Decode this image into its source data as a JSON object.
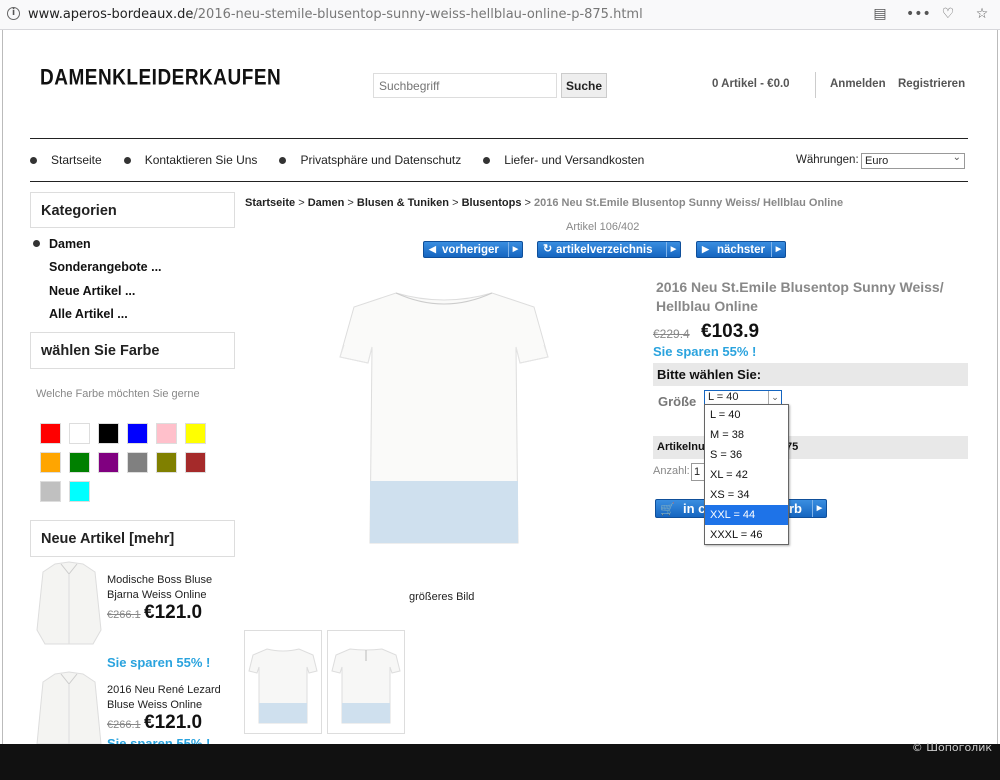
{
  "browser": {
    "url_host": "www.aperos-bordeaux.de",
    "url_path": "/2016-neu-stemile-blusentop-sunny-weiss-hellblau-online-p-875.html"
  },
  "header": {
    "logo": "DAMENKLEIDERKAUFEN",
    "search_placeholder": "Suchbegriff",
    "search_button": "Suche",
    "cart": "0 Artikel - €0.0",
    "login": "Anmelden",
    "register": "Registrieren"
  },
  "nav": {
    "items": [
      {
        "label": "Startseite"
      },
      {
        "label": "Kontaktieren Sie Uns"
      },
      {
        "label": "Privatsphäre und Datenschutz"
      },
      {
        "label": "Liefer- und Versandkosten"
      }
    ],
    "currency_label": "Währungen:",
    "currency_value": "Euro"
  },
  "sidebar": {
    "categories_title": "Kategorien",
    "categories": [
      {
        "label": "Damen"
      },
      {
        "label": "Sonderangebote ..."
      },
      {
        "label": "Neue Artikel ..."
      },
      {
        "label": "Alle Artikel ..."
      }
    ],
    "color_title": "wählen Sie Farbe",
    "color_hint": "Welche Farbe möchten Sie gerne",
    "colors": [
      "#ff0000",
      "#ffffff",
      "#000000",
      "#0000ff",
      "#ffc0cb",
      "#ffff00",
      "#ffa500",
      "#008000",
      "#800080",
      "#808080",
      "#808000",
      "#a52a2a",
      "#c0c0c0",
      "#00ffff"
    ],
    "new_title": "Neue Artikel [mehr]",
    "new_items": [
      {
        "name": "Modische Boss Bluse Bjarna Weiss Online",
        "old_price": "€266.1",
        "price": "€121.0",
        "save": "Sie sparen 55% !"
      },
      {
        "name": "2016 Neu René Lezard Bluse Weiss Online",
        "old_price": "€266.1",
        "price": "€121.0",
        "save": "Sie sparen 55% !"
      }
    ]
  },
  "breadcrumb": {
    "items": [
      "Startseite",
      "Damen",
      "Blusen & Tuniken",
      "Blusentops"
    ],
    "sep": " > ",
    "current": "2016 Neu St.Emile Blusentop Sunny Weiss/ Hellblau Online"
  },
  "product": {
    "article_count": "Artikel 106/402",
    "btn_prev": "vorheriger",
    "btn_list": "artikelverzeichnis",
    "btn_next": "nächster",
    "bigger_image": "größeres Bild",
    "title": "2016 Neu St.Emile Blusentop Sunny Weiss/ Hellblau Online",
    "old_price": "€229.4",
    "price": "€103.9",
    "save": "Sie sparen 55% !",
    "choose": "Bitte wählen Sie:",
    "size_label": "Größe",
    "size_selected": "L = 40",
    "size_options": [
      "L = 40",
      "M = 38",
      "S = 36",
      "XL = 42",
      "XS = 34",
      "XXL = 44",
      "XXXL = 46"
    ],
    "highlighted_option_index": 5,
    "artno_label": "Artikelnu",
    "artno_tail": "75",
    "qty_label": "Anzahl:",
    "qty_value": "1",
    "cart_btn_start": "in c",
    "cart_btn_end": "rb"
  },
  "watermark": "© Шопоголик"
}
